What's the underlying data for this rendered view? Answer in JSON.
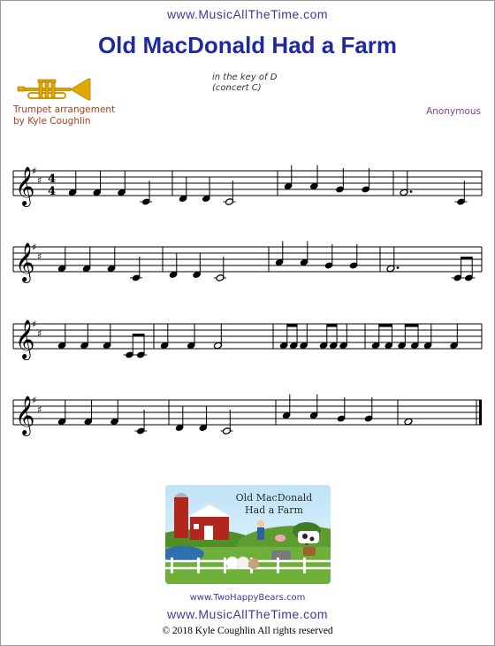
{
  "site_url_top": "www.MusicAllTheTime.com",
  "title": "Old MacDonald Had a Farm",
  "key_line1": "in the key of D",
  "key_line2": "(concert C)",
  "arrangement_line1": "Trumpet arrangement",
  "arrangement_line2": "by Kyle Coughlin",
  "composer": "Anonymous",
  "time_signature": {
    "top": "4",
    "bottom": "4"
  },
  "instrument_icon": "trumpet-icon",
  "promo": {
    "title_line1": "Old MacDonald",
    "title_line2": "Had a Farm"
  },
  "promo_link": "www.TwoHappyBears.com",
  "site_url_bottom": "www.MusicAllTheTime.com",
  "copyright": "© 2018 Kyle Coughlin All rights reserved",
  "colors": {
    "title": "#1e2aa0",
    "link": "#3a3aa0",
    "arrangement": "#b23a1a",
    "composer": "#8a3aa0",
    "trumpet": "#e0a800"
  },
  "music": {
    "staves": [
      {
        "measures": [
          [
            [
              "F4",
              "q"
            ],
            [
              "F4",
              "q"
            ],
            [
              "F4",
              "q"
            ],
            [
              "C4",
              "q"
            ]
          ],
          [
            [
              "D4",
              "q"
            ],
            [
              "D4",
              "q"
            ],
            [
              "C4",
              "h"
            ]
          ],
          [
            [
              "A4",
              "q"
            ],
            [
              "A4",
              "q"
            ],
            [
              "G4",
              "q"
            ],
            [
              "G4",
              "q"
            ]
          ],
          [
            [
              "F4",
              "h."
            ],
            [
              "C4",
              "q"
            ]
          ]
        ]
      },
      {
        "measures": [
          [
            [
              "F4",
              "q"
            ],
            [
              "F4",
              "q"
            ],
            [
              "F4",
              "q"
            ],
            [
              "C4",
              "q"
            ]
          ],
          [
            [
              "D4",
              "q"
            ],
            [
              "D4",
              "q"
            ],
            [
              "C4",
              "h"
            ]
          ],
          [
            [
              "A4",
              "q"
            ],
            [
              "A4",
              "q"
            ],
            [
              "G4",
              "q"
            ],
            [
              "G4",
              "q"
            ]
          ],
          [
            [
              "F4",
              "h."
            ],
            [
              "C4",
              "e"
            ],
            [
              "C4",
              "e"
            ]
          ]
        ]
      },
      {
        "measures": [
          [
            [
              "F4",
              "q"
            ],
            [
              "F4",
              "q"
            ],
            [
              "F4",
              "q"
            ],
            [
              "C4",
              "e"
            ],
            [
              "C4",
              "e"
            ]
          ],
          [
            [
              "F4",
              "q"
            ],
            [
              "F4",
              "q"
            ],
            [
              "F4",
              "h"
            ]
          ],
          [
            [
              "F4",
              "e"
            ],
            [
              "F4",
              "e"
            ],
            [
              "F4",
              "q"
            ],
            [
              "F4",
              "e"
            ],
            [
              "F4",
              "e"
            ],
            [
              "F4",
              "q"
            ]
          ],
          [
            [
              "F4",
              "e"
            ],
            [
              "F4",
              "e"
            ],
            [
              "F4",
              "e"
            ],
            [
              "F4",
              "e"
            ],
            [
              "F4",
              "q"
            ],
            [
              "F4",
              "q"
            ]
          ]
        ]
      },
      {
        "measures": [
          [
            [
              "F4",
              "q"
            ],
            [
              "F4",
              "q"
            ],
            [
              "F4",
              "q"
            ],
            [
              "C4",
              "q"
            ]
          ],
          [
            [
              "D4",
              "q"
            ],
            [
              "D4",
              "q"
            ],
            [
              "C4",
              "h"
            ]
          ],
          [
            [
              "A4",
              "q"
            ],
            [
              "A4",
              "q"
            ],
            [
              "G4",
              "q"
            ],
            [
              "G4",
              "q"
            ]
          ],
          [
            [
              "F4",
              "w"
            ]
          ]
        ]
      }
    ]
  }
}
